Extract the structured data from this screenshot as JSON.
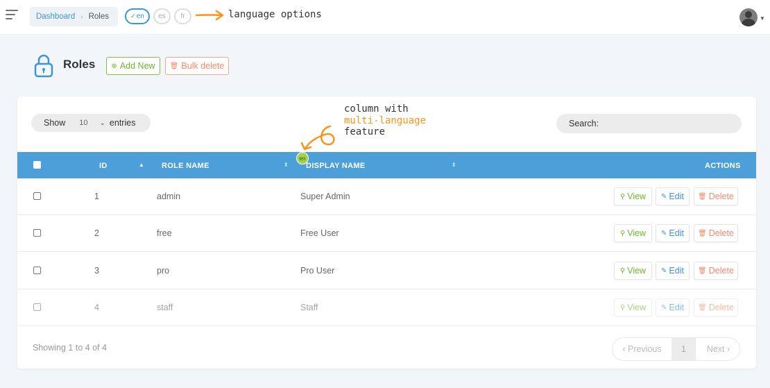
{
  "breadcrumb": {
    "root": "Dashboard",
    "current": "Roles"
  },
  "languages": [
    "en",
    "es",
    "fr"
  ],
  "annotations": {
    "language": "language options",
    "column_line1": "column with",
    "column_line2": "multi-language",
    "column_line3": "feature"
  },
  "page": {
    "title": "Roles",
    "add_label": "Add New",
    "bulk_label": "Bulk delete"
  },
  "controls": {
    "show_label": "Show",
    "show_value": "10",
    "entries_label": "entries",
    "search_label": "Search:"
  },
  "table": {
    "headers": {
      "id": "ID",
      "role_name": "ROLE NAME",
      "display_name": "DISPLAY NAME",
      "actions": "ACTIONS"
    },
    "column_lang_badge": "en",
    "rows": [
      {
        "id": "1",
        "role_name": "admin",
        "display_name": "Super Admin"
      },
      {
        "id": "2",
        "role_name": "free",
        "display_name": "Free User"
      },
      {
        "id": "3",
        "role_name": "pro",
        "display_name": "Pro User"
      },
      {
        "id": "4",
        "role_name": "staff",
        "display_name": "Staff"
      }
    ],
    "actions": {
      "view": "View",
      "edit": "Edit",
      "delete": "Delete"
    }
  },
  "footer": {
    "info": "Showing 1 to 4 of 4",
    "prev": "‹ Previous",
    "page": "1",
    "next": "Next ›"
  },
  "colors": {
    "accent": "#4d9fd9",
    "success": "#6cb52e",
    "danger": "#ef8a6c",
    "annotation": "#f7941d"
  },
  "icons": {
    "menu": "hamburger-icon",
    "lock": "lock-icon",
    "avatar": "user-avatar-icon"
  }
}
